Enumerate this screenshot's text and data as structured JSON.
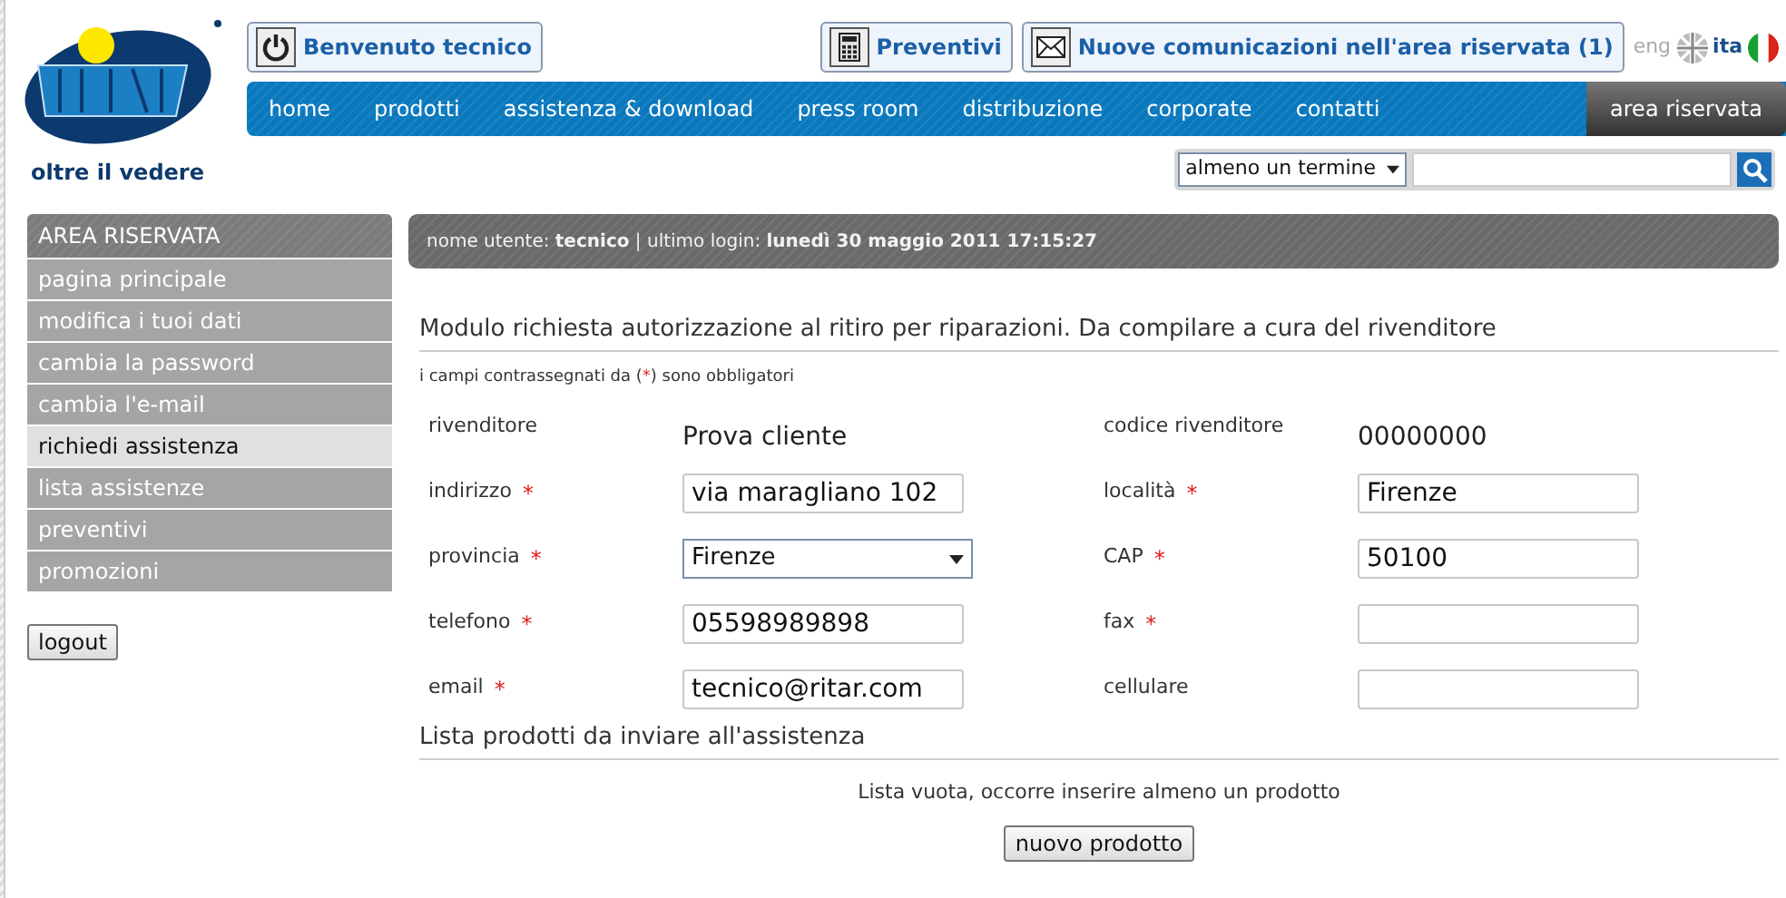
{
  "logo": {
    "tagline": "oltre il vedere"
  },
  "top_buttons": [
    {
      "kind": "power",
      "label": "Benvenuto tecnico"
    },
    {
      "kind": "calculator",
      "label": "Preventivi"
    },
    {
      "kind": "mail",
      "label": "Nuove comunicazioni nell'area riservata (1)"
    }
  ],
  "languages": [
    {
      "kind": "uk",
      "label": "eng",
      "selected": false
    },
    {
      "kind": "it",
      "label": "ita",
      "selected": true
    }
  ],
  "nav": {
    "items": [
      "home",
      "prodotti",
      "assistenza & download",
      "press room",
      "distribuzione",
      "corporate",
      "contatti"
    ],
    "reserved": "area riservata"
  },
  "search": {
    "mode": "almeno un termine"
  },
  "sidebar": {
    "title": "AREA RISERVATA",
    "items": [
      {
        "label": "pagina principale",
        "selected": false
      },
      {
        "label": "modifica i tuoi dati",
        "selected": false
      },
      {
        "label": "cambia la password",
        "selected": false
      },
      {
        "label": "cambia l'e-mail",
        "selected": false
      },
      {
        "label": "richiedi assistenza",
        "selected": true
      },
      {
        "label": "lista assistenze",
        "selected": false
      },
      {
        "label": "preventivi",
        "selected": false
      },
      {
        "label": "promozioni",
        "selected": false
      }
    ],
    "logout": "logout"
  },
  "user_bar": "nome utente: **tecnico** | ultimo login: **lunedì 30 maggio 2011 17:15:27**",
  "form": {
    "title": "Modulo richiesta autorizzazione al ritiro per riparazioni. Da compilare a cura del rivenditore",
    "note": {
      "before": "i campi contrassegnati da (",
      "mark": "*",
      "after": ") sono obbligatori"
    },
    "rows": [
      [
        {
          "label": "rivenditore",
          "kind": "text",
          "value": "Prova cliente"
        },
        {
          "label": "codice rivenditore",
          "kind": "text",
          "value": "00000000"
        }
      ],
      [
        {
          "label": "indirizzo",
          "mark": "*",
          "kind": "input",
          "value": "via maragliano 102"
        },
        {
          "label": "località",
          "mark": "*",
          "kind": "input",
          "value": "Firenze"
        }
      ],
      [
        {
          "label": "provincia",
          "mark": "*",
          "kind": "select",
          "value": "Firenze"
        },
        {
          "label": "CAP",
          "mark": "*",
          "kind": "input",
          "value": "50100"
        }
      ],
      [
        {
          "label": "telefono",
          "mark": "*",
          "kind": "input",
          "value": "05598989898"
        },
        {
          "label": "fax",
          "mark": "*",
          "kind": "input"
        }
      ],
      [
        {
          "label": "email",
          "mark": "*",
          "kind": "input",
          "value": "tecnico@ritar.com"
        },
        {
          "label": "cellulare",
          "kind": "input"
        }
      ]
    ]
  },
  "products": {
    "title": "Lista prodotti da inviare all'assistenza",
    "empty": "Lista vuota, occorre inserire almeno un prodotto",
    "button": "nuovo prodotto"
  }
}
